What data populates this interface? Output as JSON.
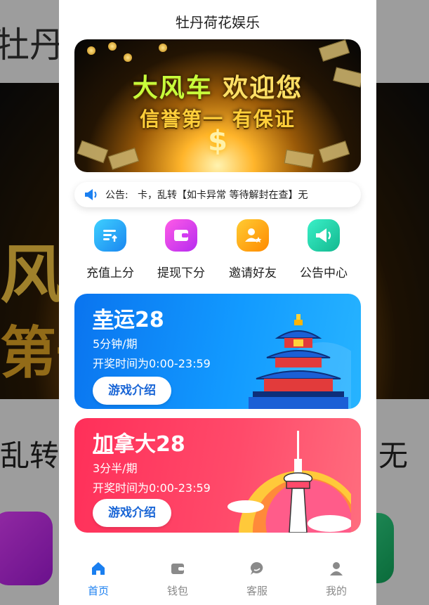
{
  "app": {
    "title": "牡丹荷花娱乐"
  },
  "banner": {
    "line1_a": "大风车",
    "line1_b": "欢迎您",
    "line2": "信誉第一  有保证",
    "icon": "dollar-icon"
  },
  "notice": {
    "label": "公告:",
    "text": "卡，乱转【如卡异常 等待解封在查】无",
    "icon": "speaker-icon"
  },
  "quick_actions": [
    {
      "label": "充值上分",
      "icon": "recharge-icon",
      "color": "#1a86f0"
    },
    {
      "label": "提现下分",
      "icon": "wallet-icon",
      "color": "#b62bf0"
    },
    {
      "label": "邀请好友",
      "icon": "invite-icon",
      "color": "#ff8a00"
    },
    {
      "label": "公告中心",
      "icon": "megaphone-icon",
      "color": "#13b88f"
    }
  ],
  "games": [
    {
      "name": "幸运28",
      "period": "5分钟/期",
      "time": "开奖时间为0:00-23:59",
      "button": "游戏介绍",
      "color": "#129aff"
    },
    {
      "name": "加拿大28",
      "period": "3分半/期",
      "time": "开奖时间为0:00-23:59",
      "button": "游戏介绍",
      "color": "#ff4a6a"
    }
  ],
  "tabbar": [
    {
      "label": "首页",
      "icon": "home-icon",
      "active": true
    },
    {
      "label": "钱包",
      "icon": "wallet-icon",
      "active": false
    },
    {
      "label": "客服",
      "icon": "chat-icon",
      "active": false
    },
    {
      "label": "我的",
      "icon": "user-icon",
      "active": false
    }
  ],
  "colors": {
    "active_tab": "#1a7ff0",
    "inactive_tab": "#8a8a8a",
    "background": "#f2f2f2"
  },
  "background": {
    "title_fragment": "牡丹",
    "banner_text_a": "风车",
    "banner_text_b": "第一",
    "notice_left": "乱转【",
    "notice_right": "无"
  }
}
